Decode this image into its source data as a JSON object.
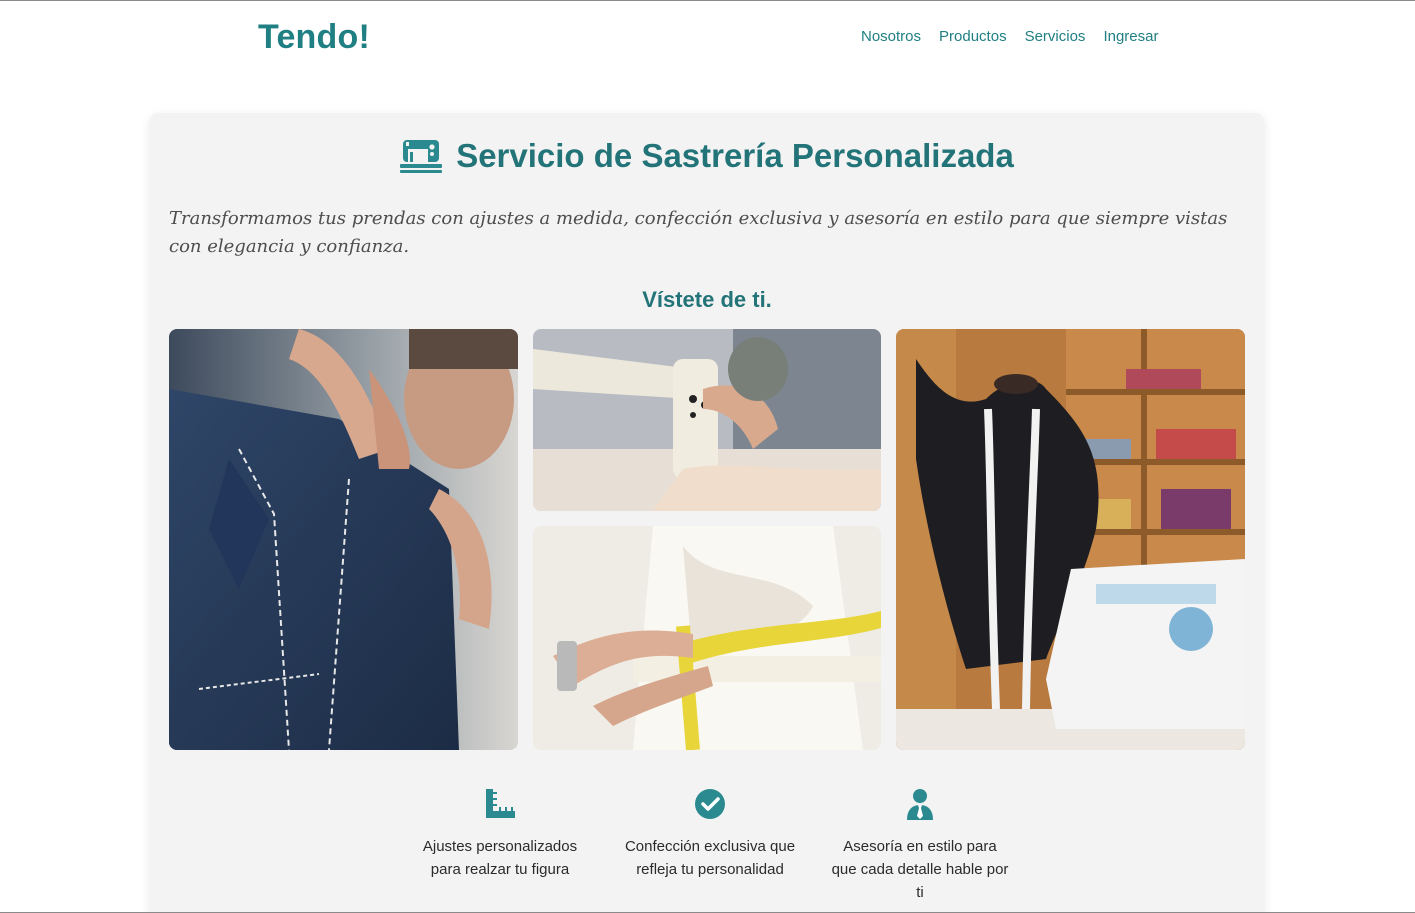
{
  "header": {
    "brand": "Tendo!",
    "nav": [
      "Nosotros",
      "Productos",
      "Servicios",
      "Ingresar"
    ]
  },
  "service": {
    "icon": "sewing-machine-icon",
    "title": "Servicio de Sastrería Personalizada",
    "intro": "Transformamos tus prendas con ajustes a medida, confección exclusiva y asesoría en estilo para que siempre vistas con elegancia y confianza.",
    "tagline": "Vístete de ti."
  },
  "gallery": [
    {
      "name": "tailor-jacket-photo"
    },
    {
      "name": "sewing-machine-photo"
    },
    {
      "name": "waist-measuring-photo"
    },
    {
      "name": "mannequin-workshop-photo"
    }
  ],
  "features": [
    {
      "icon": "ruler-icon",
      "label": "Ajustes personalizados para realzar tu figura"
    },
    {
      "icon": "check-circle-icon",
      "label": "Confección exclusiva que refleja tu personalidad"
    },
    {
      "icon": "user-tie-icon",
      "label": "Asesoría en estilo para que cada detalle hable por ti"
    }
  ],
  "colors": {
    "accent": "#1f7f82",
    "card_bg": "#f3f3f3",
    "icon": "#2a8a8f"
  }
}
